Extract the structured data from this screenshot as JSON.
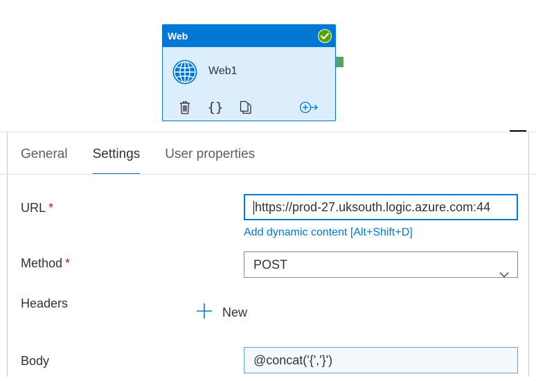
{
  "activity": {
    "type_label": "Web",
    "name": "Web1",
    "status": "succeeded",
    "icons": [
      "globe-icon",
      "delete-icon",
      "code-braces-icon",
      "copy-icon",
      "add-output-icon",
      "check-icon"
    ]
  },
  "tabs": [
    {
      "label": "General",
      "active": false
    },
    {
      "label": "Settings",
      "active": true
    },
    {
      "label": "User properties",
      "active": false
    }
  ],
  "form": {
    "url": {
      "label": "URL",
      "required_marker": "*",
      "value": "https://prod-27.uksouth.logic.azure.com:44"
    },
    "dynamic_content_link": "Add dynamic content [Alt+Shift+D]",
    "method": {
      "label": "Method",
      "required_marker": "*",
      "value": "POST"
    },
    "headers": {
      "label": "Headers",
      "new_button_label": "New"
    },
    "body": {
      "label": "Body",
      "value": "@concat('{','}')"
    }
  },
  "colors": {
    "accent": "#0078d4",
    "node_fill": "#dcedfb",
    "success": "#57a300",
    "required": "#a4262c"
  }
}
